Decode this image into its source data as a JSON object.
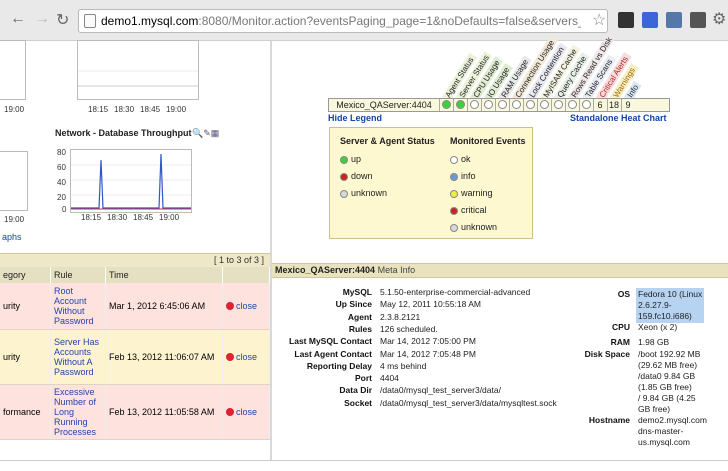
{
  "browser": {
    "url_host": "demo1.mysql.com",
    "url_rest": ":8080/Monitor.action?eventsPaging_page=1&noDefaults=false&servers_gro..."
  },
  "left": {
    "top_chart": {
      "x_ticks": [
        "18:15",
        "18:30",
        "18:45",
        "19:00"
      ],
      "left_tick": "19:00"
    },
    "network_chart": {
      "title": "Network - Database Throughput",
      "y_ticks": [
        "80",
        "60",
        "40",
        "20",
        "0"
      ],
      "x_ticks": [
        "18:15",
        "18:30",
        "18:45",
        "19:00"
      ],
      "left_tick": "19:00"
    },
    "graphs_link": "aphs",
    "pager": "[ 1 to 3 of 3 ]",
    "table": {
      "headers": [
        "egory",
        "Rule",
        "Time"
      ],
      "rows": [
        {
          "category": "urity",
          "rule": "Root Account Without Password",
          "time": "Mar 1, 2012 6:45:06 AM",
          "action": "close"
        },
        {
          "category": "urity",
          "rule": "Server Has Accounts Without A Password",
          "time": "Feb 13, 2012 11:06:07 AM",
          "action": "close"
        },
        {
          "category": "formance",
          "rule": "Excessive Number of Long Running Processes",
          "time": "Feb 13, 2012 11:05:58 AM",
          "action": "close"
        }
      ]
    }
  },
  "right": {
    "heat_columns": [
      "Agent Status",
      "Server Status",
      "CPU Usage",
      "IO Usage",
      "RAM Usage",
      "Connection Usage",
      "Lock Contention",
      "MyISAM Cache",
      "Query Cache",
      "Rows Read vs Disk",
      "Table Scans",
      "Critical Alerts",
      "Warnings",
      "Info"
    ],
    "heat_row": {
      "server": "Mexico_QAServer:4404",
      "counts": [
        "6",
        "18",
        "9"
      ]
    },
    "hide_legend": "Hide Legend",
    "standalone": "Standalone Heat Chart",
    "legend": {
      "status_title": "Server & Agent Status",
      "events_title": "Monitored Events",
      "status_items": [
        "up",
        "down",
        "unknown"
      ],
      "event_items": [
        "ok",
        "info",
        "warning",
        "critical",
        "unknown"
      ]
    },
    "meta": {
      "server": "Mexico_QAServer:4404",
      "suffix": "Meta Info",
      "left_fields": [
        {
          "label": "MySQL",
          "value": "5.1.50-enterprise-commercial-advanced"
        },
        {
          "label": "Up Since",
          "value": "May 12, 2011 10:55:18 AM"
        },
        {
          "label": "Agent",
          "value": "2.3.8.2121"
        },
        {
          "label": "Rules",
          "value": "126 scheduled."
        },
        {
          "label": "Last MySQL Contact",
          "value": "Mar 14, 2012 7:05:00 PM"
        },
        {
          "label": "Last Agent Contact",
          "value": "Mar 14, 2012 7:05:48 PM"
        },
        {
          "label": "Reporting Delay",
          "value": "4 ms behind"
        },
        {
          "label": "Port",
          "value": "4404"
        },
        {
          "label": "Data Dir",
          "value": "/data0/mysql_test_server3/data/"
        },
        {
          "label": "Socket",
          "value": "/data0/mysql_test_server3/data/mysqltest.sock"
        }
      ],
      "os_label": "OS",
      "os_value": [
        "Fedora 10 (Linux",
        "2.6.27.9-",
        "159.fc10.i686)"
      ],
      "cpu_label": "CPU",
      "cpu_value": "Xeon (x 2)",
      "ram_label": "RAM",
      "ram_value": "1.98 GB",
      "disk_label": "Disk Space",
      "disk_value": [
        "/boot 192.92 MB",
        "(29.62 MB free)",
        "/data0 9.84 GB",
        "(1.85 GB free)",
        "/ 9.84 GB (4.25",
        "GB free)"
      ],
      "host_label": "Hostname",
      "host_value": [
        "demo2.mysql.com",
        "dns-master-",
        "us.mysql.com"
      ]
    }
  },
  "colors": {
    "up": "#3cd23c",
    "down": "#cc2222",
    "unknown": "#d8d8d8",
    "ok": "#ffffff",
    "info": "#6a9ad8",
    "warning": "#f0ee3a",
    "critical": "#cc2222",
    "unknown_event": "#d8d8d8"
  }
}
